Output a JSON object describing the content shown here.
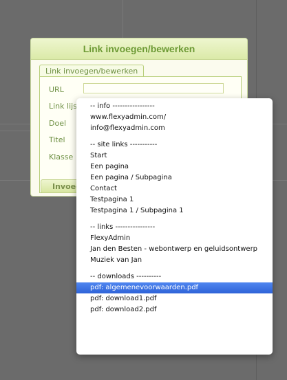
{
  "dialog": {
    "title": "Link invoegen/bewerken",
    "tab_label": "Link invoegen/bewerken",
    "fields": {
      "url": "URL",
      "link_list": "Link lijst",
      "target": "Doel",
      "title": "Titel",
      "class": "Klasse"
    },
    "url_value": "",
    "submit_label": "Invoegen",
    "check_mark": "✓"
  },
  "dropdown": {
    "groups": [
      {
        "header": "-- info -----------------",
        "items": [
          "www.flexyadmin.com/",
          "info@flexyadmin.com"
        ]
      },
      {
        "header": "-- site links -----------",
        "items": [
          "Start",
          "Een pagina",
          "Een pagina / Subpagina",
          "Contact",
          "Testpagina 1",
          "Testpagina 1 / Subpagina 1"
        ]
      },
      {
        "header": "-- links ----------------",
        "items": [
          "FlexyAdmin",
          "Jan den Besten - webontwerp en geluidsontwerp",
          "Muziek van Jan"
        ]
      },
      {
        "header": "-- downloads ----------",
        "items": [
          "pdf: algemenevoorwaarden.pdf",
          "pdf: download1.pdf",
          "pdf: download2.pdf"
        ]
      }
    ],
    "selected_item": "pdf: algemenevoorwaarden.pdf"
  }
}
